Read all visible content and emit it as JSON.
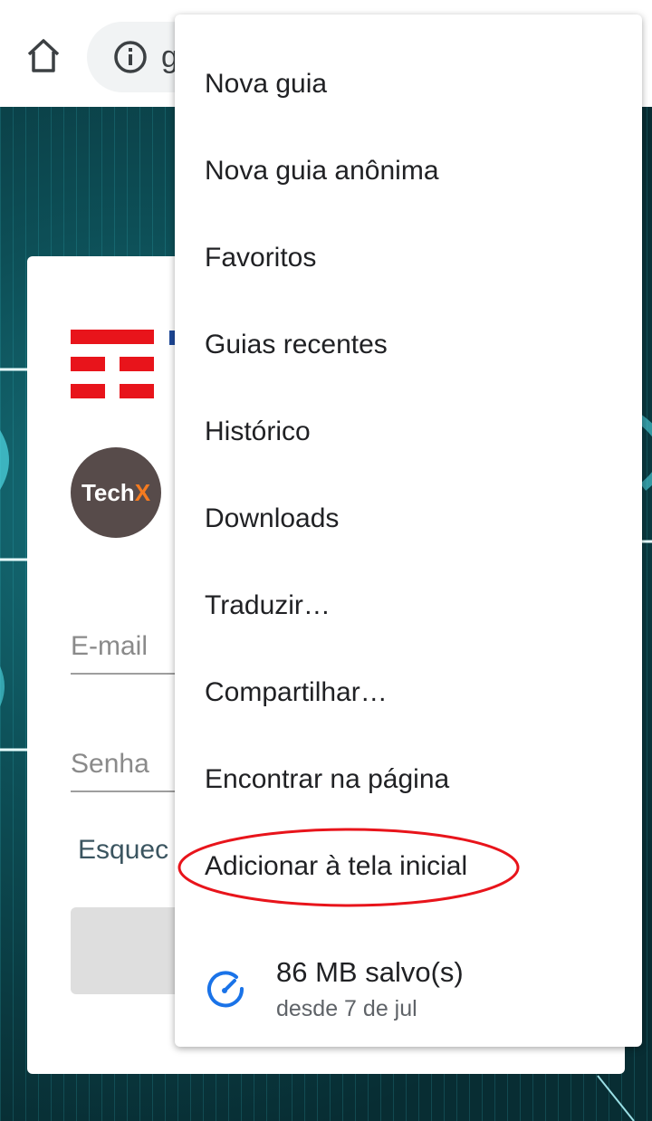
{
  "toolbar": {
    "url_partial": "g"
  },
  "page": {
    "avatar_text_main": "Tech",
    "avatar_text_accent": "X",
    "email_placeholder": "E-mail",
    "password_placeholder": "Senha",
    "forgot_partial": "Esquec"
  },
  "menu": {
    "items": [
      {
        "label": "Nova guia"
      },
      {
        "label": "Nova guia anônima"
      },
      {
        "label": "Favoritos"
      },
      {
        "label": "Guias recentes"
      },
      {
        "label": "Histórico"
      },
      {
        "label": "Downloads"
      },
      {
        "label": "Traduzir…"
      },
      {
        "label": "Compartilhar…"
      },
      {
        "label": "Encontrar na página"
      },
      {
        "label": "Adicionar à tela inicial"
      }
    ],
    "data_saver": {
      "title": "86 MB salvo(s)",
      "subtitle": "desde 7 de jul"
    }
  },
  "colors": {
    "accent_blue": "#1a73e8",
    "highlight_red": "#e8141b",
    "brand_orange": "#f57b20"
  }
}
